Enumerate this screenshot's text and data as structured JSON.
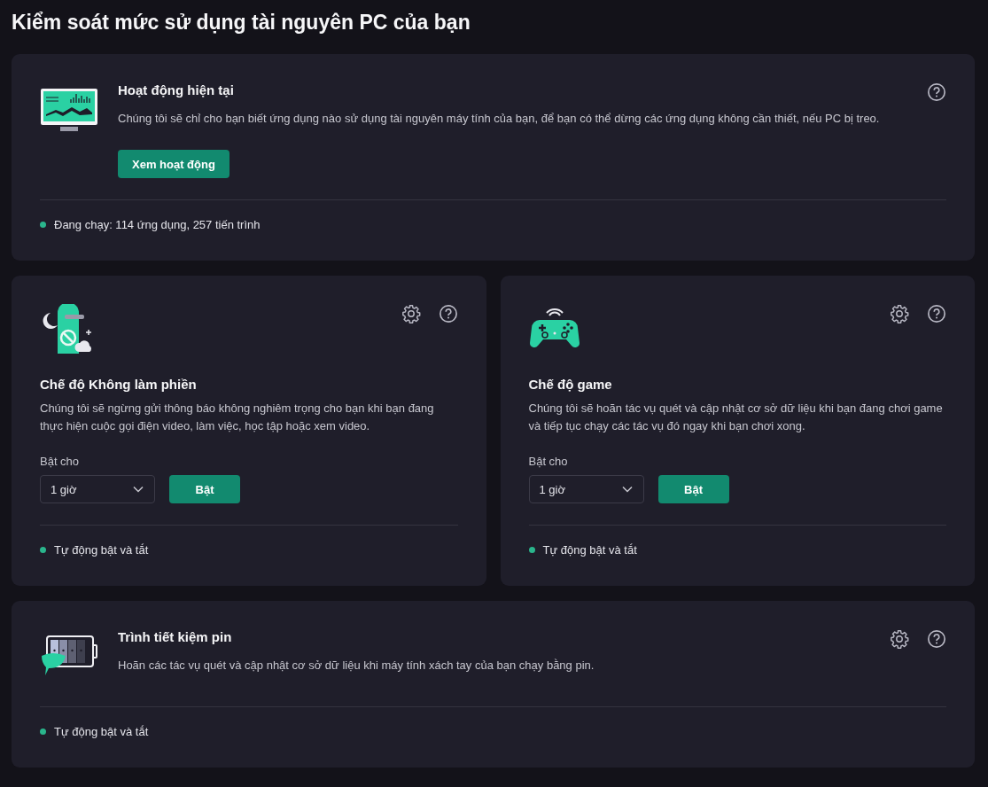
{
  "page_title": "Kiểm soát mức sử dụng tài nguyên PC của bạn",
  "cards": [
    {
      "kind": "wide",
      "title": "Hoạt động hiện tại",
      "description": "Chúng tôi sẽ chỉ cho bạn biết ứng dụng nào sử dụng tài nguyên máy tính của bạn, để bạn có thể dừng các ứng dụng không cần thiết, nếu PC bị treo.",
      "button": "Xem hoạt động",
      "settings": false,
      "status": "Đang chạy: 114 ứng dụng, 257 tiến trình"
    },
    {
      "kind": "mode",
      "title": "Chế độ Không làm phiền",
      "description": "Chúng tôi sẽ ngừng gửi thông báo không nghiêm trọng cho bạn khi bạn đang thực hiện cuộc gọi điện video, làm việc, học tập hoặc xem video.",
      "select_label": "Bật cho",
      "select_value": "1 giờ",
      "button": "Bật",
      "settings": true,
      "status": "Tự động bật và tắt"
    },
    {
      "kind": "mode",
      "title": "Chế độ game",
      "description": "Chúng tôi sẽ hoãn tác vụ quét và cập nhật cơ sở dữ liệu khi bạn đang chơi game và tiếp tục chạy các tác vụ đó ngay khi bạn chơi xong.",
      "select_label": "Bật cho",
      "select_value": "1 giờ",
      "button": "Bật",
      "settings": true,
      "status": "Tự động bật và tắt"
    },
    {
      "kind": "wide",
      "title": "Trình tiết kiệm pin",
      "description": "Hoãn các tác vụ quét và cập nhật cơ sở dữ liệu khi máy tính xách tay của bạn chạy bằng pin.",
      "settings": true,
      "status": "Tự động bật và tắt"
    }
  ]
}
